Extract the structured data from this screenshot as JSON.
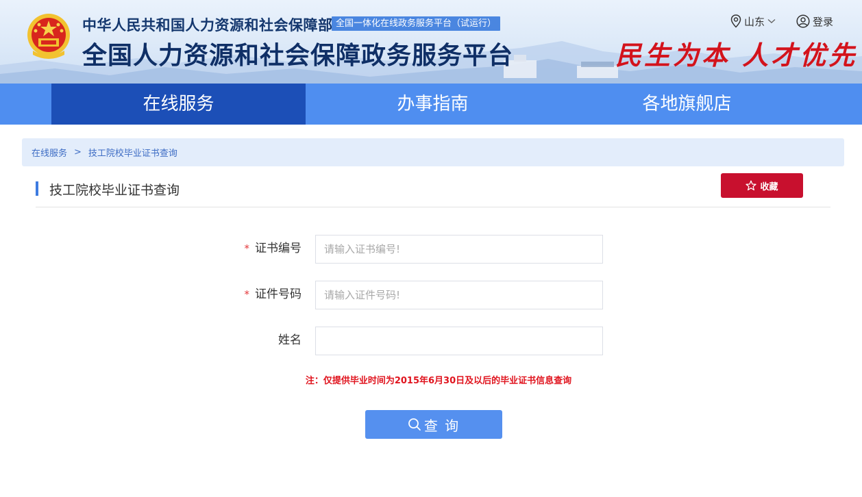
{
  "header": {
    "ministry": "中华人民共和国人力资源和社会保障部",
    "badge": "全国一体化在线政务服务平台（试运行）",
    "title": "全国人力资源和社会保障政务服务平台",
    "slogan": "民生为本 人才优先",
    "region": "山东",
    "login": "登录"
  },
  "nav": {
    "items": [
      {
        "label": "在线服务",
        "active": true
      },
      {
        "label": "办事指南",
        "active": false
      },
      {
        "label": "各地旗舰店",
        "active": false
      }
    ]
  },
  "breadcrumb": {
    "home": "在线服务",
    "separator": ">",
    "current": "技工院校毕业证书查询"
  },
  "page": {
    "title": "技工院校毕业证书查询",
    "favorite_label": "收藏"
  },
  "form": {
    "required_mark": "*",
    "cert_number": {
      "label": "证书编号",
      "placeholder": "请输入证书编号!",
      "value": ""
    },
    "id_number": {
      "label": "证件号码",
      "placeholder": "请输入证件号码!",
      "value": ""
    },
    "name": {
      "label": "姓名",
      "placeholder": "",
      "value": ""
    },
    "note": "注：仅提供毕业时间为2015年6月30日及以后的毕业证书信息查询",
    "submit_label": "查 询"
  },
  "colors": {
    "nav_bg": "#4f8ef0",
    "nav_active": "#1c4fb7",
    "favorite_btn": "#c8102e",
    "query_btn": "#5590ef",
    "note": "#e0141e"
  },
  "icons": {
    "emblem": "national-emblem-icon",
    "region": "location-pin-icon",
    "dropdown": "chevron-down-icon",
    "login": "user-circle-icon",
    "favorite": "star-icon",
    "search": "search-icon"
  }
}
